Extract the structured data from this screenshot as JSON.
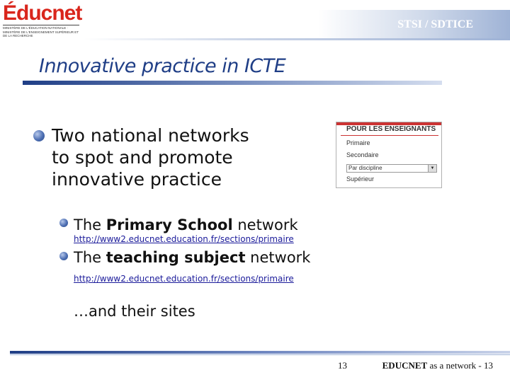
{
  "header": {
    "logo_text": "Éducnet",
    "logo_subtitle": "Ministère de l'éducation nationale · Ministère de l'enseignement supérieur et de la recherche",
    "tag": "STSI / SDTICE"
  },
  "slide": {
    "title": "Innovative practice in ICTE",
    "bullet_main": [
      "Two national networks",
      "to spot and promote",
      "innovative practice"
    ],
    "networks": [
      {
        "prefix": "The ",
        "emphasis": "Primary School",
        "suffix": " network",
        "url": "http://www2.educnet.education.fr/sections/primaire"
      },
      {
        "prefix": "The ",
        "emphasis": "teaching subject",
        "suffix": " network",
        "url": "http://www2.educnet.education.fr/sections/primaire"
      }
    ],
    "closing": "…and their sites"
  },
  "menu_snapshot": {
    "heading": "POUR LES ENSEIGNANTS",
    "items": [
      "Primaire",
      "Secondaire"
    ],
    "select_value": "Par discipline",
    "last_item": "Supérieur",
    "accent": "#cc3333"
  },
  "footer": {
    "page_number": "13",
    "brand": "EDUCNET",
    "label": " as a network - 13"
  },
  "colors": {
    "title": "#1f3e86",
    "logo": "#d9261c"
  }
}
